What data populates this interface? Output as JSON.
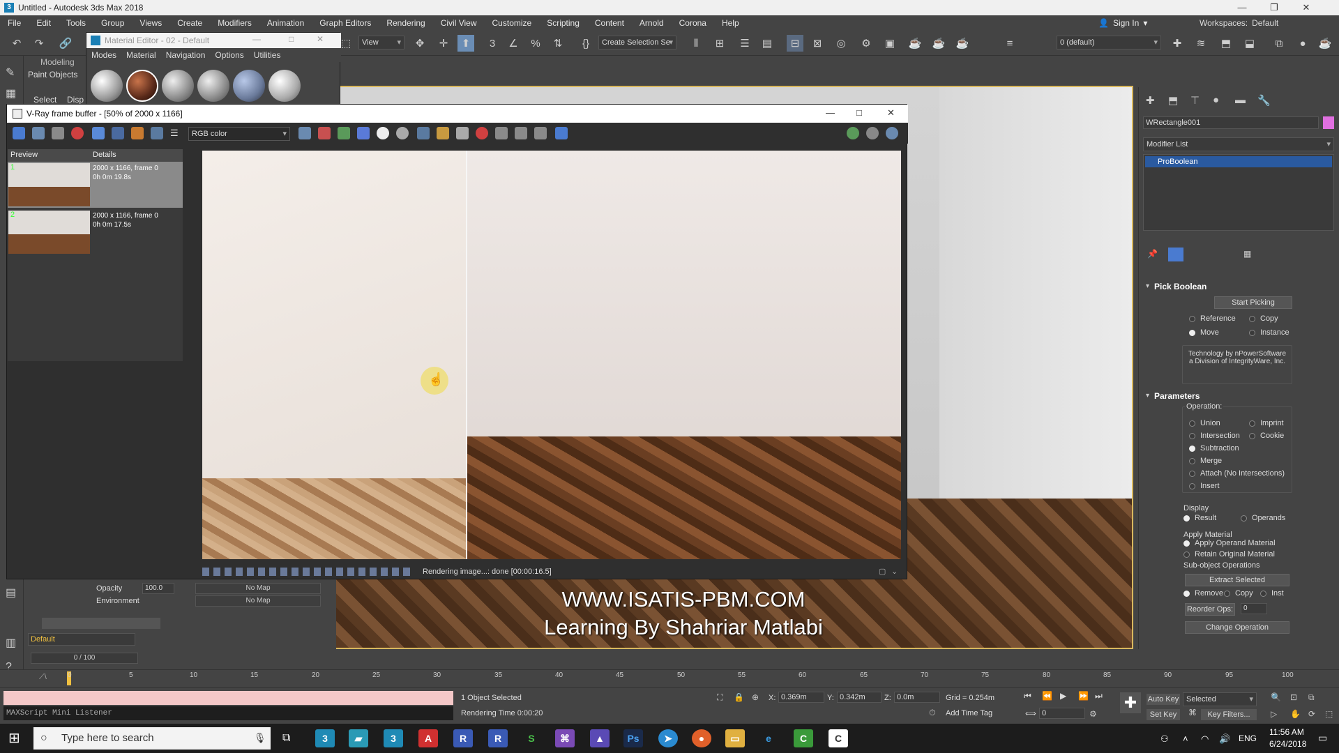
{
  "window": {
    "title": "Untitled - Autodesk 3ds Max 2018"
  },
  "menu": [
    "File",
    "Edit",
    "Tools",
    "Group",
    "Views",
    "Create",
    "Modifiers",
    "Animation",
    "Graph Editors",
    "Rendering",
    "Civil View",
    "Customize",
    "Scripting",
    "Content",
    "Arnold",
    "Corona",
    "Help"
  ],
  "signin": "Sign In",
  "workspace": {
    "label": "Workspaces:",
    "value": "Default"
  },
  "toolbar": {
    "view_dropdown": "View",
    "selection_set": "Create Selection Se",
    "layer_dropdown": "0 (default)"
  },
  "ribbon": {
    "modeling": "Modeling",
    "paint_objects": "Paint Objects",
    "select": "Select",
    "display": "Disp"
  },
  "material_editor": {
    "title": "Material Editor - 02 - Default",
    "menu": [
      "Modes",
      "Material",
      "Navigation",
      "Options",
      "Utilities"
    ],
    "opacity_label": "Opacity",
    "opacity_value": "100.0",
    "opacity_map": "No Map",
    "environment_label": "Environment",
    "environment_map": "No Map",
    "default_dropdown": "Default",
    "frame_counter": "0 / 100"
  },
  "vfb": {
    "title": "V-Ray frame buffer - [50% of 2000 x 1166]",
    "channel": "RGB color",
    "history_headers": [
      "Preview",
      "Details"
    ],
    "history": [
      {
        "index": "1",
        "line1": "2000 x 1166, frame 0",
        "line2": "0h 0m 19.8s"
      },
      {
        "index": "2",
        "line1": "2000 x 1166, frame 0",
        "line2": "0h 0m 17.5s"
      }
    ],
    "status": "Rendering image...: done [00:00:16.5]"
  },
  "watermark": {
    "line1": "WWW.ISATIS-PBM.COM",
    "line2": "Learning By Shahriar Matlabi"
  },
  "command_panel": {
    "object_name": "WRectangle001",
    "modifier_list": "Modifier List",
    "stack_item": "ProBoolean",
    "pick_boolean": {
      "title": "Pick Boolean",
      "start_picking": "Start Picking",
      "reference": "Reference",
      "copy": "Copy",
      "move": "Move",
      "instance": "Instance",
      "credit": "Technology by nPowerSoftware a Division of IntegrityWare, Inc."
    },
    "parameters": {
      "title": "Parameters",
      "operation_label": "Operation:",
      "union": "Union",
      "imprint": "Imprint",
      "intersection": "Intersection",
      "cookie": "Cookie",
      "subtraction": "Subtraction",
      "merge": "Merge",
      "attach": "Attach (No Intersections)",
      "insert": "Insert",
      "display_label": "Display",
      "result": "Result",
      "operands": "Operands",
      "apply_material_label": "Apply Material",
      "apply_operand": "Apply Operand Material",
      "retain_original": "Retain Original Material",
      "subobject_label": "Sub-object Operations",
      "extract_selected": "Extract Selected",
      "remove": "Remove",
      "copy": "Copy",
      "inst": "Inst",
      "reorder_ops": "Reorder Ops:",
      "reorder_value": "0",
      "change_operation": "Change Operation"
    }
  },
  "timeline": {
    "ticks": [
      "0",
      "5",
      "10",
      "15",
      "20",
      "25",
      "30",
      "35",
      "40",
      "45",
      "50",
      "55",
      "60",
      "65",
      "70",
      "75",
      "80",
      "85",
      "90",
      "95",
      "100"
    ]
  },
  "status": {
    "maxscript": "MAXScript Mini Listener",
    "selected": "1 Object Selected",
    "render_time": "Rendering Time 0:00:20",
    "x_label": "X:",
    "x_value": "0.369m",
    "y_label": "Y:",
    "y_value": "0.342m",
    "z_label": "Z:",
    "z_value": "0.0m",
    "grid": "Grid = 0.254m",
    "add_time_tag": "Add Time Tag",
    "auto_key": "Auto Key",
    "selected_dropdown": "Selected",
    "set_key": "Set Key",
    "key_filters": "Key Filters...",
    "frame_value": "0"
  },
  "taskbar": {
    "search_placeholder": "Type here to search",
    "lang": "ENG",
    "time": "11:56 AM",
    "date": "6/24/2018"
  }
}
